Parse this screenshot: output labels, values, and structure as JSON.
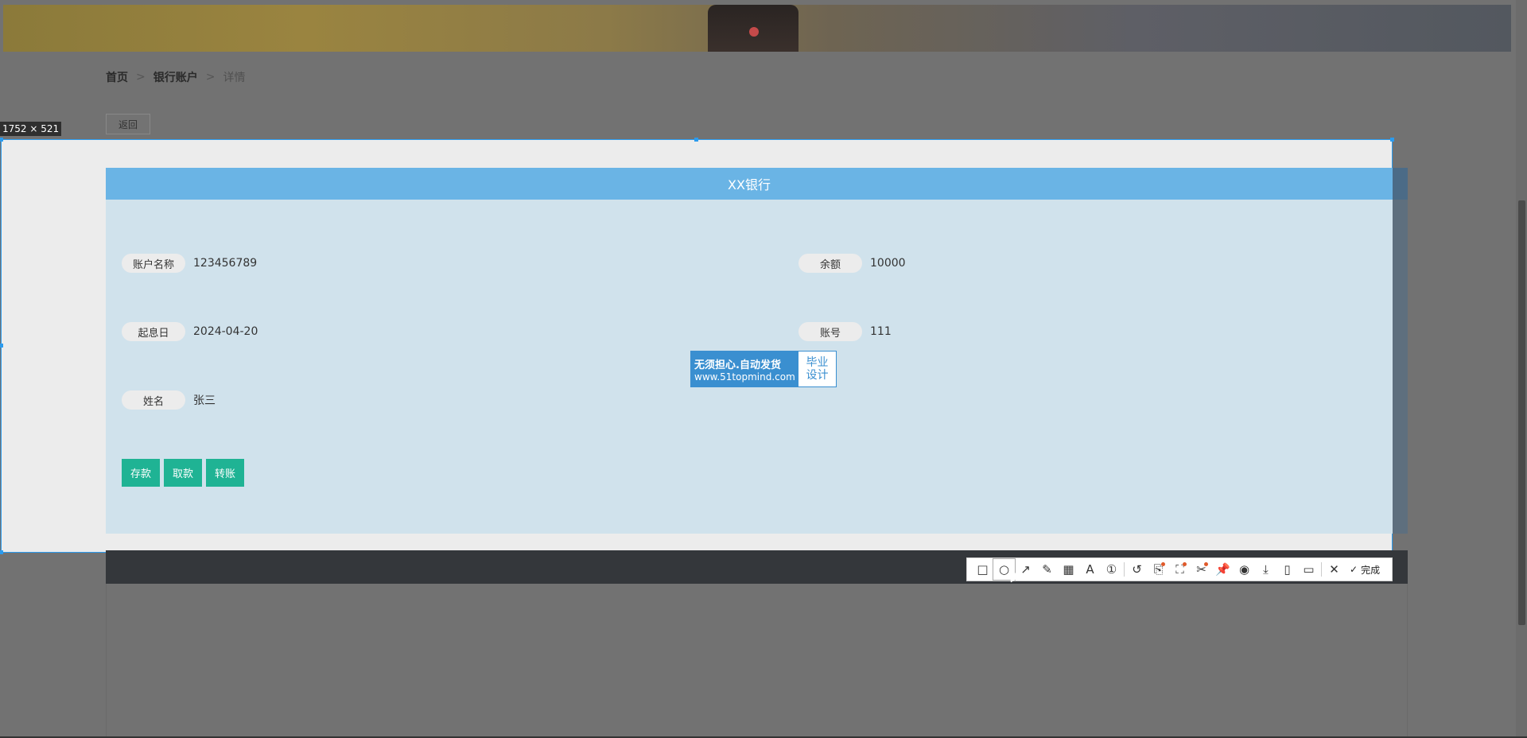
{
  "breadcrumb": {
    "home": "首页",
    "section": "银行账户",
    "current": "详情",
    "sep": ">"
  },
  "back_button": "返回",
  "capture_size": "1752 × 521",
  "card": {
    "title": "XX银行",
    "fields": {
      "account_name": {
        "label": "账户名称",
        "value": "123456789"
      },
      "balance": {
        "label": "余额",
        "value": "10000"
      },
      "start_date": {
        "label": "起息日",
        "value": "2024-04-20"
      },
      "account_no": {
        "label": "账号",
        "value": "111"
      },
      "name": {
        "label": "姓名",
        "value": "张三"
      }
    },
    "actions": {
      "deposit": "存款",
      "withdraw": "取款",
      "transfer": "转账"
    }
  },
  "watermark": {
    "line1": "无须担心.自动发货",
    "line2": "www.51topmind.com",
    "side1": "毕业",
    "side2": "设计"
  },
  "toolbar": {
    "icons": {
      "rect": "□",
      "ellipse": "○",
      "arrow": "↗",
      "pen": "✎",
      "mosaic": "▦",
      "text": "A",
      "number": "①",
      "undo": "↺",
      "ocr": "⎘",
      "translate": "⛶",
      "scan": "✂",
      "pin": "📌",
      "record": "◉",
      "save": "⤓",
      "long": "▯",
      "bookmark": "▭",
      "close": "✕",
      "check": "✓"
    },
    "done_label": "完成"
  }
}
